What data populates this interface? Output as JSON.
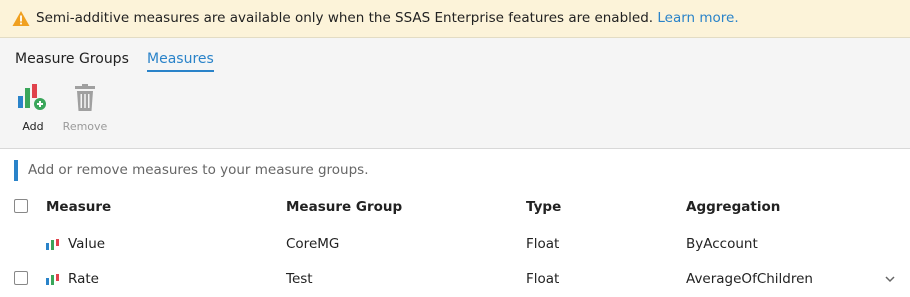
{
  "banner": {
    "text": "Semi-additive measures are available only when the SSAS Enterprise features are enabled.",
    "link": "Learn more.",
    "icon": "warning-icon",
    "accent": "#f0a020"
  },
  "tabs": [
    {
      "label": "Measure Groups",
      "active": false
    },
    {
      "label": "Measures",
      "active": true
    }
  ],
  "toolbar": {
    "add_label": "Add",
    "remove_label": "Remove",
    "remove_enabled": false
  },
  "hint": "Add or remove measures to your measure groups.",
  "table": {
    "columns": [
      "Measure",
      "Measure Group",
      "Type",
      "Aggregation"
    ],
    "rows": [
      {
        "measure": "Value",
        "group": "CoreMG",
        "type": "Float",
        "aggregation": "ByAccount",
        "checkbox": false
      },
      {
        "measure": "Rate",
        "group": "Test",
        "type": "Float",
        "aggregation": "AverageOfChildren",
        "checkbox": true
      }
    ]
  },
  "colors": {
    "accent_blue": "#2a83c9",
    "bar_blue": "#2a83c9",
    "bar_green": "#3aa65a",
    "bar_red": "#e0424c"
  }
}
